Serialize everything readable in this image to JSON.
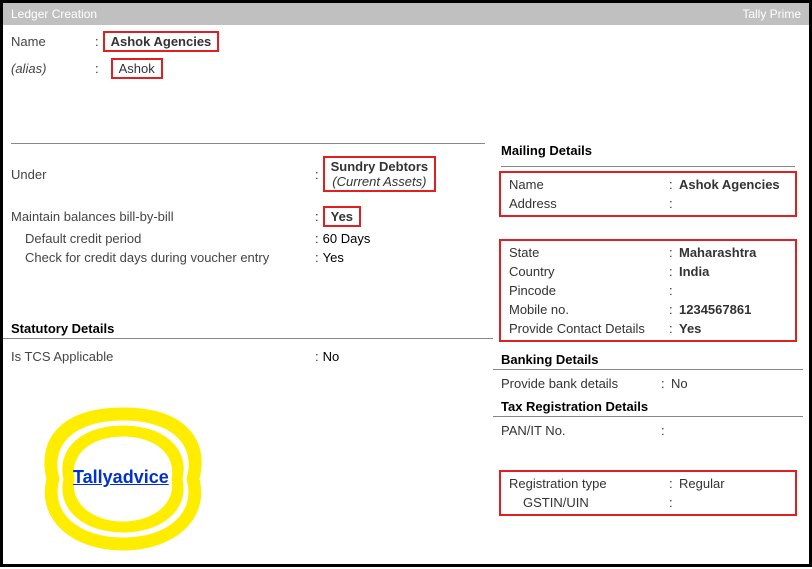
{
  "titlebar": {
    "left": "Ledger Creation",
    "right": "Tally Prime"
  },
  "name": {
    "label": "Name",
    "value": "Ashok Agencies"
  },
  "alias": {
    "label": "(alias)",
    "value": "Ashok"
  },
  "under": {
    "label": "Under",
    "value": "Sundry Debtors",
    "sub": "(Current Assets)"
  },
  "billbybill": {
    "label": "Maintain balances bill-by-bill",
    "value": "Yes"
  },
  "creditperiod": {
    "label": "Default credit period",
    "value": "60 Days"
  },
  "checkcredit": {
    "label": "Check for credit days during voucher entry",
    "value": "Yes"
  },
  "statutory_head": "Statutory Details",
  "tcs": {
    "label": "Is TCS Applicable",
    "value": "No"
  },
  "mailing_head": "Mailing Details",
  "mailing_name": {
    "label": "Name",
    "value": "Ashok Agencies"
  },
  "mailing_address": {
    "label": "Address",
    "value": ""
  },
  "state": {
    "label": "State",
    "value": "Maharashtra"
  },
  "country": {
    "label": "Country",
    "value": "India"
  },
  "pincode": {
    "label": "Pincode",
    "value": ""
  },
  "mobile": {
    "label": "Mobile no.",
    "value": "1234567861"
  },
  "contact": {
    "label": "Provide Contact Details",
    "value": "Yes"
  },
  "banking_head": "Banking Details",
  "bankdetails": {
    "label": "Provide bank details",
    "value": "No"
  },
  "taxreg_head": "Tax Registration Details",
  "pan": {
    "label": "PAN/IT No.",
    "value": ""
  },
  "regtype": {
    "label": "Registration type",
    "value": "Regular"
  },
  "gstin": {
    "label": "GSTIN/UIN",
    "value": ""
  },
  "watermark": "Tallyadvice"
}
